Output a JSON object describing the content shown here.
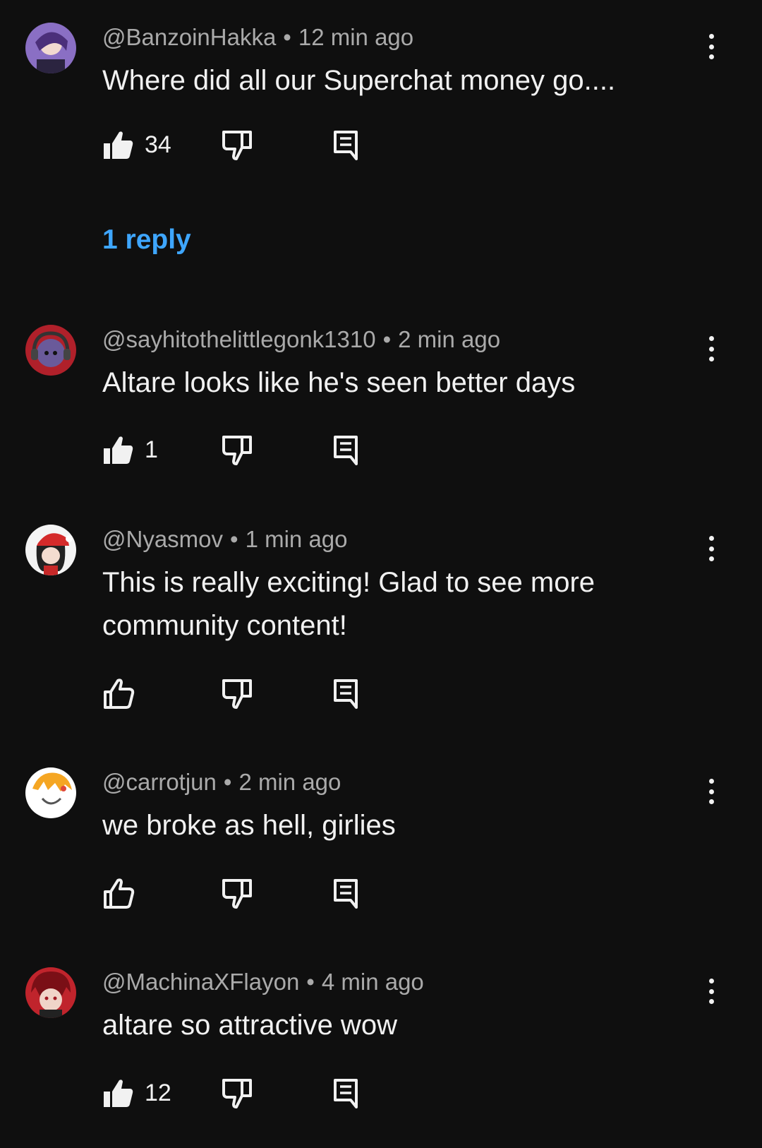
{
  "comments": [
    {
      "author": "@BanzoinHakka",
      "time": "12 min ago",
      "text": "Where did all our Superchat money go....",
      "likes": "34",
      "liked": true,
      "avatar_color": "#8a6fc4"
    },
    {
      "author": "@sayhitothelittlegonk1310",
      "time": "2 min ago",
      "text": "Altare looks like he's seen better days",
      "likes": "1",
      "liked": true,
      "avatar_color": "#b0202a"
    },
    {
      "author": "@Nyasmov",
      "time": "1 min ago",
      "text": "This is really exciting! Glad to see more community content!",
      "likes": "",
      "liked": false,
      "avatar_color": "#f4f4f4"
    },
    {
      "author": "@carrotjun",
      "time": "2 min ago",
      "text": "we broke as hell, girlies",
      "likes": "",
      "liked": false,
      "avatar_color": "#ffffff"
    },
    {
      "author": "@MachinaXFlayon",
      "time": "4 min ago",
      "text": "altare so attractive wow",
      "likes": "12",
      "liked": true,
      "avatar_color": "#c0242c"
    }
  ],
  "replies_link": "1 reply",
  "meta_separator": "•",
  "colors": {
    "background": "#0f0f0f",
    "text": "#f1f1f1",
    "meta": "#aaaaaa",
    "link": "#3ea6ff"
  },
  "icons": [
    "thumbs-up-filled-icon",
    "thumbs-up-outline-icon",
    "thumbs-down-outline-icon",
    "reply-icon",
    "more-vert-icon"
  ]
}
